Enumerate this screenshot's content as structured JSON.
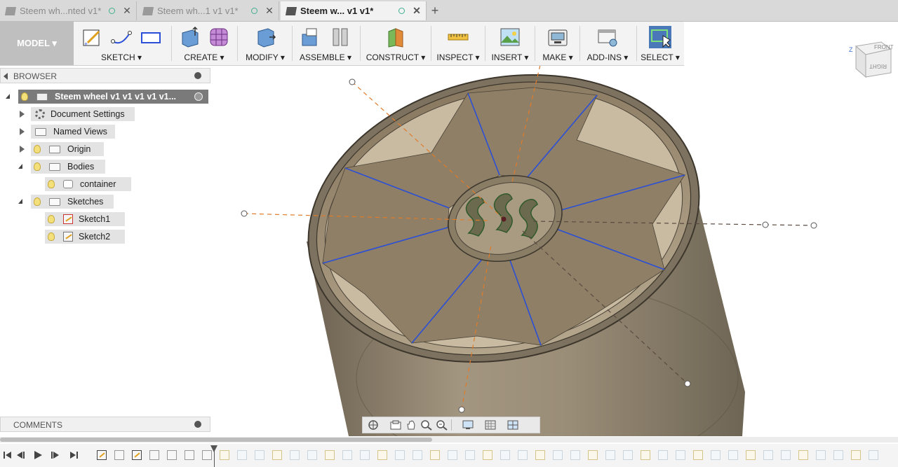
{
  "tabs": [
    {
      "label": "Steem wh...nted v1*",
      "active": false
    },
    {
      "label": "Steem wh...1 v1 v1*",
      "active": false
    },
    {
      "label": "Steem w... v1 v1*",
      "active": true
    }
  ],
  "new_tab": "+",
  "toolbar": {
    "workspace": "MODEL ▾",
    "groups": [
      {
        "label": "SKETCH ▾"
      },
      {
        "label": "CREATE ▾"
      },
      {
        "label": "MODIFY ▾"
      },
      {
        "label": "ASSEMBLE ▾"
      },
      {
        "label": "CONSTRUCT ▾"
      },
      {
        "label": "INSPECT ▾"
      },
      {
        "label": "INSERT ▾"
      },
      {
        "label": "MAKE ▾"
      },
      {
        "label": "ADD-INS ▾"
      },
      {
        "label": "SELECT ▾"
      }
    ]
  },
  "browser": {
    "title": "BROWSER",
    "root": "Steem wheel v1 v1 v1 v1 v1...",
    "items": [
      {
        "label": "Document Settings"
      },
      {
        "label": "Named Views"
      },
      {
        "label": "Origin"
      },
      {
        "label": "Bodies"
      },
      {
        "label": "container"
      },
      {
        "label": "Sketches"
      },
      {
        "label": "Sketch1"
      },
      {
        "label": "Sketch2"
      }
    ]
  },
  "comments": {
    "title": "COMMENTS"
  },
  "viewcube": {
    "face_front": "FRONT",
    "face_right": "RIGHT",
    "axis_z": "Z"
  },
  "colors": {
    "accent": "#4a78b8",
    "model": "#8a7c66",
    "sketch_line": "#2b4fd6",
    "axis_line": "#e07b2a"
  }
}
